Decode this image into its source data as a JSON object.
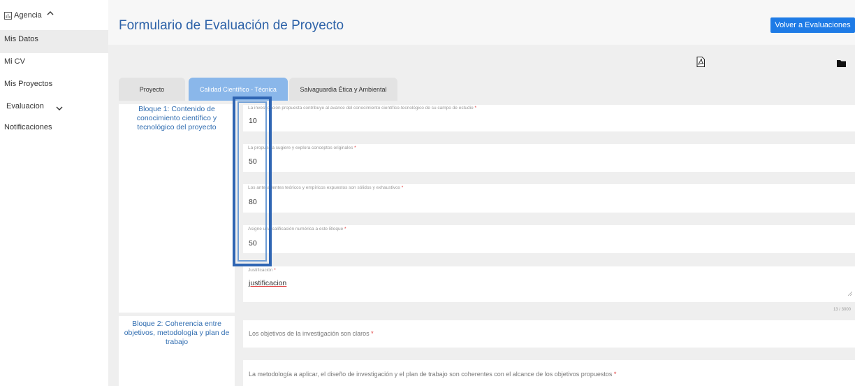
{
  "sidebar": {
    "agency_label": "Agencia",
    "items": [
      "Mis Datos",
      "Mi CV",
      "Mis Proyectos",
      "Evaluacion",
      "Notificaciones"
    ]
  },
  "header": {
    "title": "Formulario de Evaluación de Proyecto",
    "back_button": "Volver a Evaluaciones"
  },
  "tabs": [
    "Proyecto",
    "Calidad Científico - Técnica",
    "Salvaguardia Ética y Ambiental"
  ],
  "block1": {
    "title": "Bloque 1: Contenido de conocimiento científico y tecnológico del proyecto",
    "fields": [
      {
        "label": "La investigación propuesta contribuye al avance del conocimiento científico-tecnológico de su campo de estudio",
        "value": "10"
      },
      {
        "label": "La propuesta sugiere y explora conceptos originales",
        "value": "50"
      },
      {
        "label": "Los antecedentes teóricos y empíricos expuestos son sólidos y exhaustivos",
        "value": "80"
      },
      {
        "label": "Asigne una calificación numérica a este Bloque",
        "value": "50"
      }
    ],
    "justification": {
      "label": "Justificación",
      "value": "justificacion",
      "counter": "13 / 3000"
    }
  },
  "block2": {
    "title": "Bloque 2: Coherencia entre objetivos, metodología y plan de trabajo",
    "fields": [
      {
        "label": "Los objetivos de la investigación son claros"
      },
      {
        "label": "La metodología a aplicar, el diseño de investigación y el plan de trabajo son coherentes con el alcance de los objetivos propuestos"
      }
    ]
  },
  "required_mark": "*",
  "icons": {
    "agency": "chart-icon",
    "agency_toggle": "chevron-up-icon",
    "evaluacion_toggle": "chevron-down-icon",
    "pdf": "pdf-icon",
    "folder": "folder-icon"
  }
}
